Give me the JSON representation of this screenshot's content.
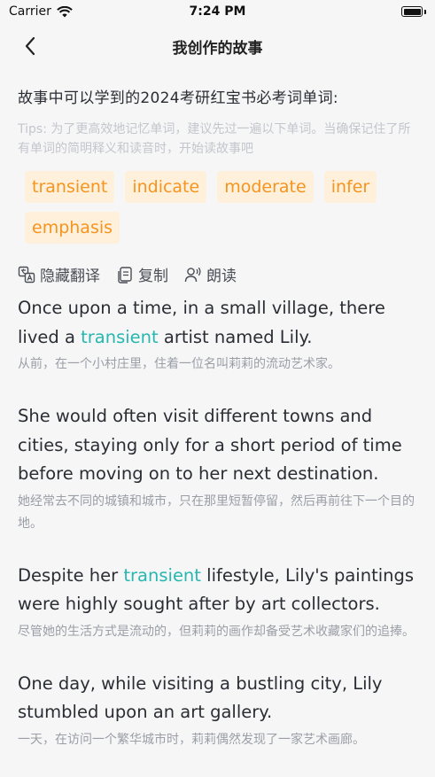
{
  "status": {
    "carrier": "Carrier",
    "time": "7:24 PM"
  },
  "nav": {
    "title": "我创作的故事"
  },
  "vocab": {
    "heading": "故事中可以学到的2024考研红宝书必考词单词:",
    "tips": "Tips: 为了更高效地记忆单词，建议先过一遍以下单词。当确保记住了所有单词的简明释义和读音时，开始读故事吧",
    "words": [
      "transient",
      "indicate",
      "moderate",
      "infer",
      "emphasis"
    ]
  },
  "actions": {
    "hide_translation": "隐藏翻译",
    "copy": "复制",
    "read_aloud": "朗读"
  },
  "story": [
    {
      "en_before": "Once upon a time, in a small village, there lived a ",
      "highlight": "transient",
      "en_after": " artist named Lily.",
      "zh": "从前，在一个小村庄里，住着一位名叫莉莉的流动艺术家。"
    },
    {
      "en_before": "She would often visit different towns and cities, staying only for a short period of time before moving on to her next destination.",
      "highlight": "",
      "en_after": "",
      "zh": "她经常去不同的城镇和城市，只在那里短暂停留，然后再前往下一个目的地。"
    },
    {
      "en_before": "Despite her ",
      "highlight": "transient",
      "en_after": " lifestyle, Lily's paintings were highly sought after by art collectors.",
      "zh": "尽管她的生活方式是流动的，但莉莉的画作却备受艺术收藏家们的追捧。"
    },
    {
      "en_before": "One day, while visiting a bustling city, Lily stumbled upon an art gallery.",
      "highlight": "",
      "en_after": "",
      "zh": "一天，在访问一个繁华城市时，莉莉偶然发现了一家艺术画廊。"
    }
  ],
  "colors": {
    "highlight": "#26b7b1",
    "chip_text": "#f5941e",
    "chip_bg": "#fff0dc"
  }
}
